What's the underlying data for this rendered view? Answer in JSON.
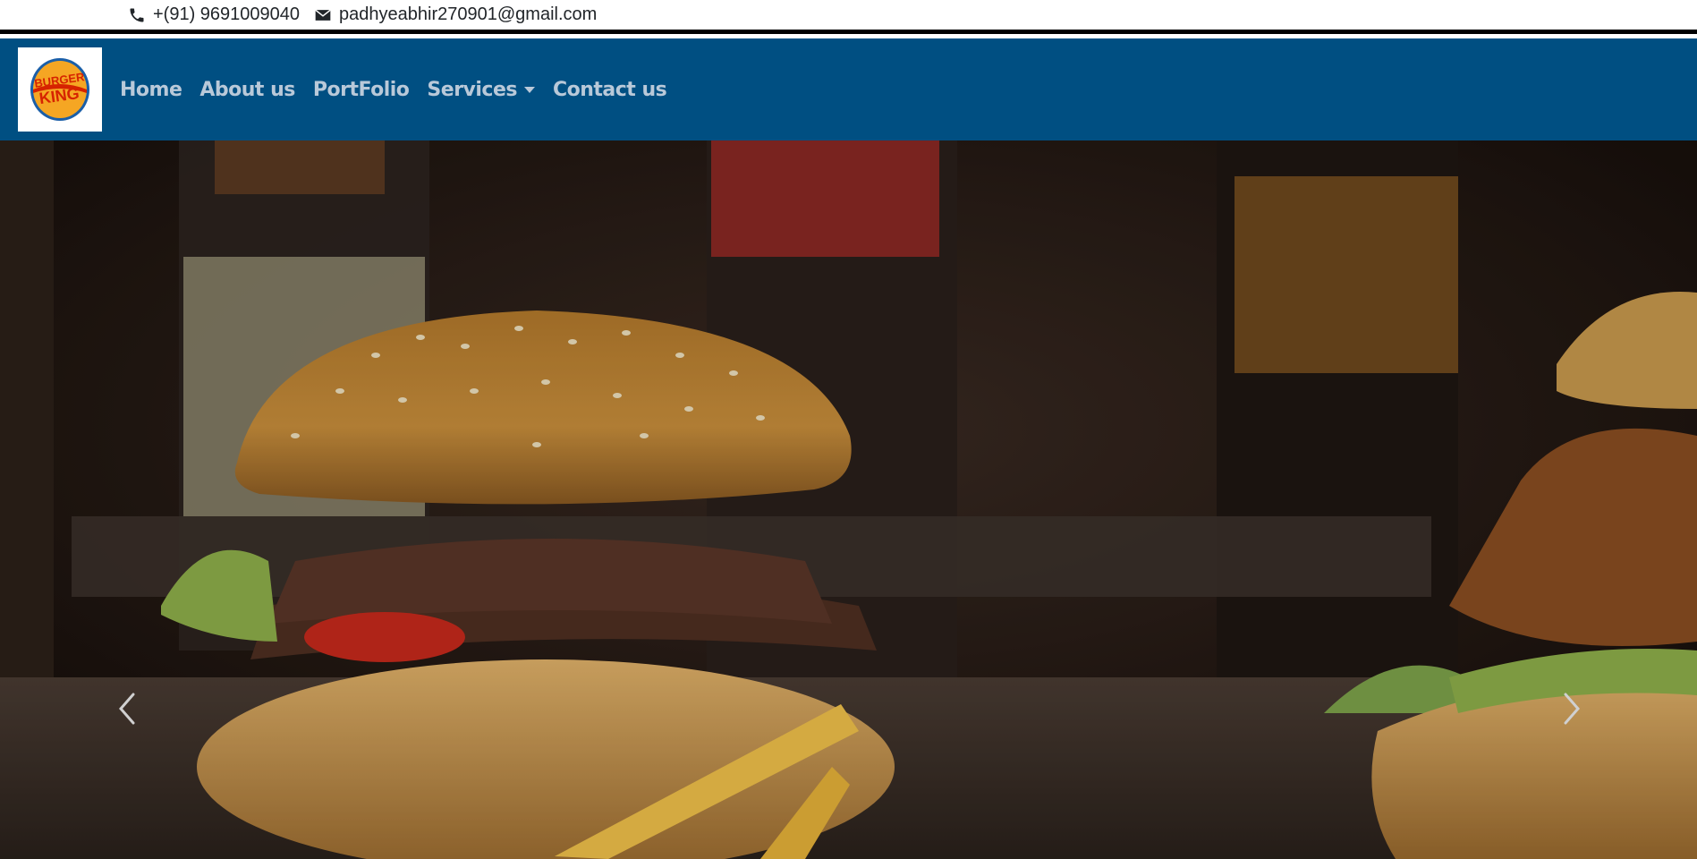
{
  "topbar": {
    "phone": "+(91) 9691009040",
    "email": "padhyeabhir270901@gmail.com",
    "phone_icon": "phone-icon",
    "email_icon": "envelope-icon"
  },
  "navbar": {
    "logo_text_top": "BURGER",
    "logo_text_bottom": "KING",
    "links": [
      {
        "label": "Home"
      },
      {
        "label": "About us"
      },
      {
        "label": "PortFolio"
      },
      {
        "label": "Services",
        "dropdown": true
      },
      {
        "label": "Contact us"
      }
    ],
    "colors": {
      "background": "#004f82",
      "link": "#b9c9d9"
    }
  },
  "carousel": {
    "prev_icon": "chevron-left-icon",
    "next_icon": "chevron-right-icon"
  }
}
